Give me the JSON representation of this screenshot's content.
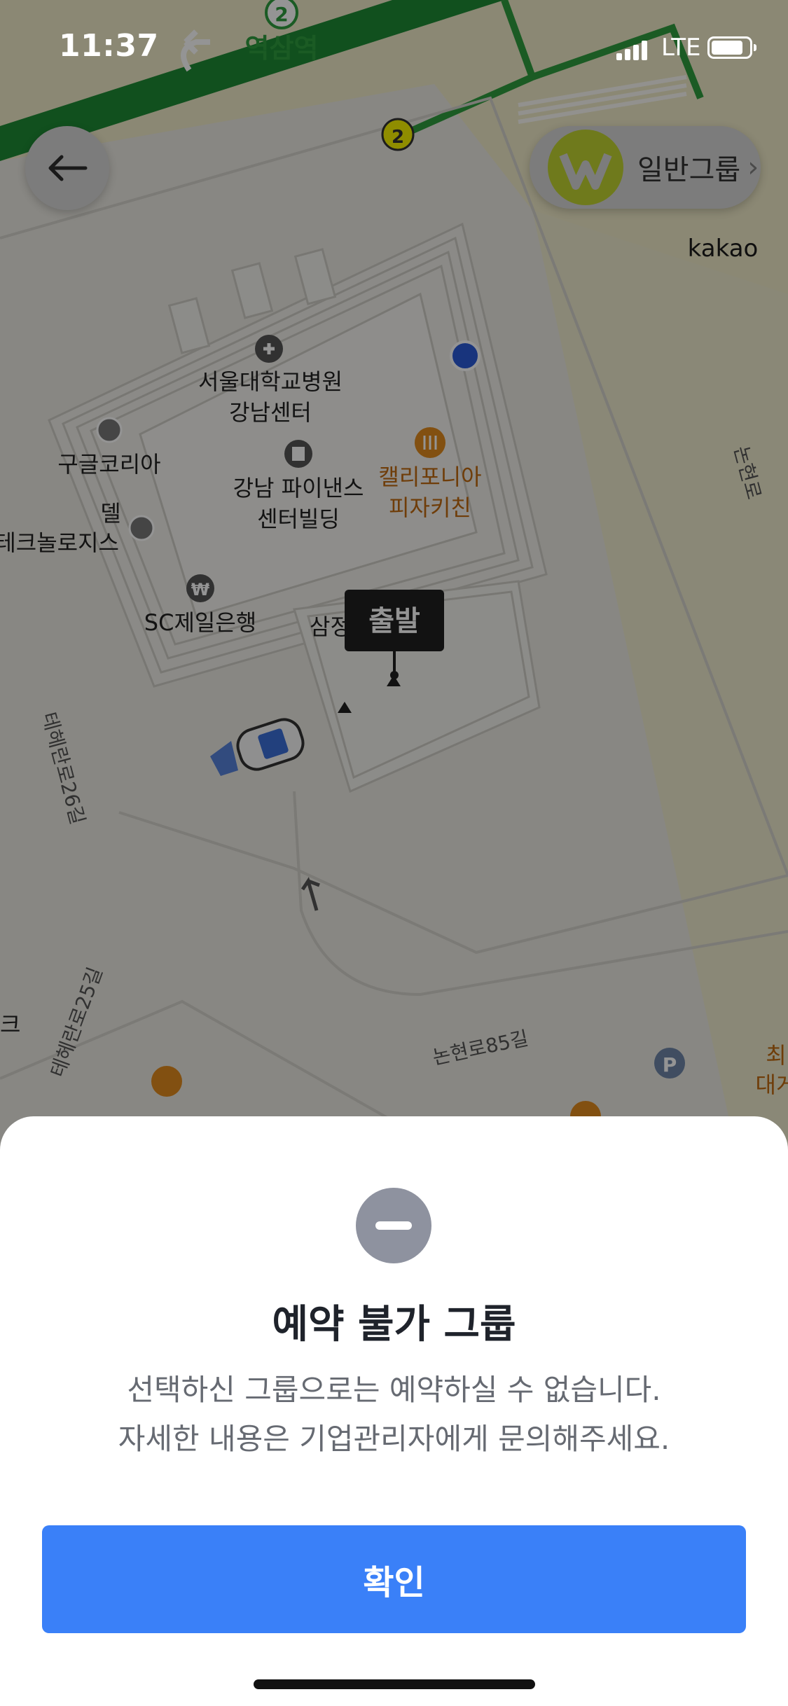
{
  "status_bar": {
    "time": "11:37",
    "network": "LTE"
  },
  "map": {
    "station_name": "역삼역",
    "line_number": "2",
    "provider": "kakao",
    "road_labels": [
      "논현로",
      "테헤란로26길",
      "논현로85길",
      "테헤란로25길"
    ],
    "pois": [
      {
        "name_line1": "서울대학교병원",
        "name_line2": "강남센터"
      },
      {
        "name_line1": "구글코리아"
      },
      {
        "name_line1": "강남 파이낸스",
        "name_line2": "센터빌딩"
      },
      {
        "name_line1": "캘리포니아",
        "name_line2": "피자키친"
      },
      {
        "name_line1": "델"
      },
      {
        "name_line1": "테크놀로지스"
      },
      {
        "name_line1": "SC제일은행"
      },
      {
        "name_line1": "삼정"
      },
      {
        "name_line1": "크"
      },
      {
        "name_line1": "최"
      },
      {
        "name_line1": "대게"
      }
    ],
    "departure_pin": "출발"
  },
  "group_chip": {
    "label": "일반그룹",
    "chevron": "›"
  },
  "sheet": {
    "title": "예약 불가 그룹",
    "desc_line1": "선택하신 그룹으로는 예약하실 수 없습니다.",
    "desc_line2": "자세한 내용은 기업관리자에게 문의해주세요.",
    "confirm_label": "확인"
  },
  "colors": {
    "accent": "#3a80f8",
    "subway_line": "#2f9e3f"
  }
}
